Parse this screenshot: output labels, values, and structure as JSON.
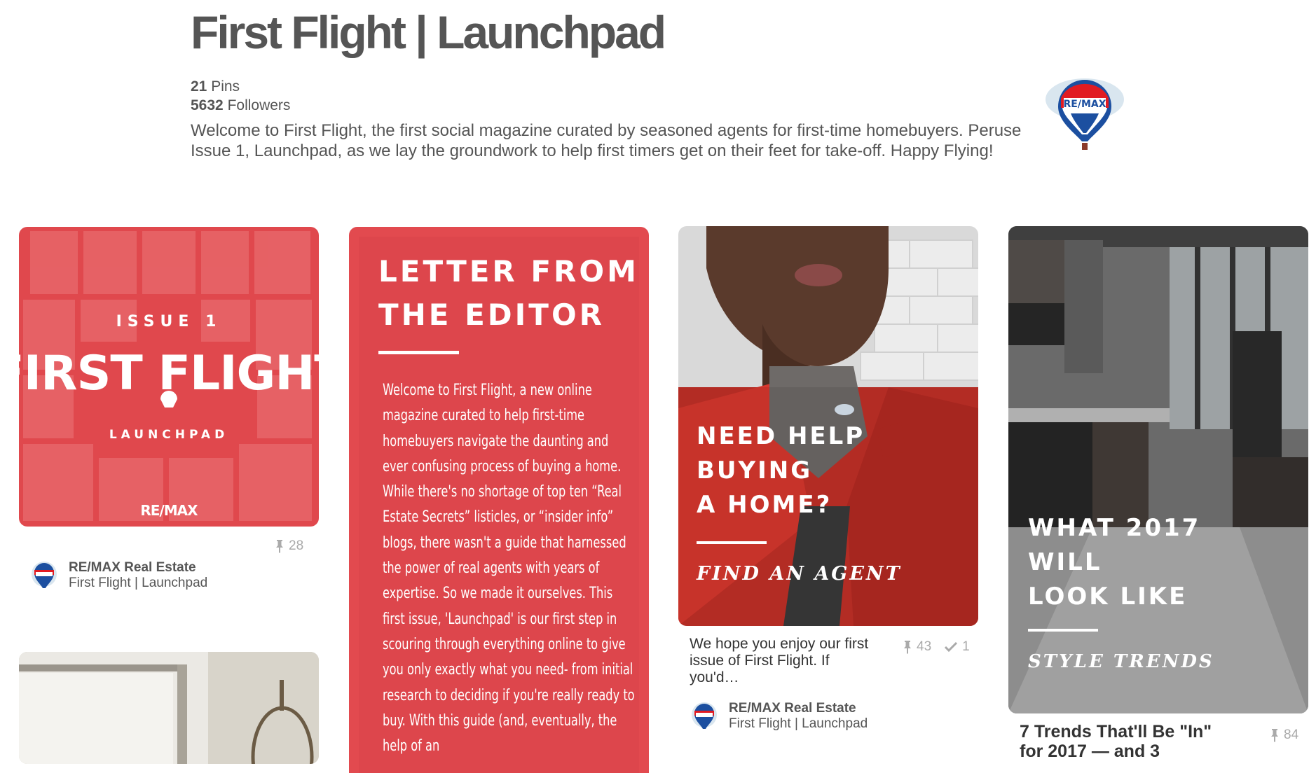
{
  "board": {
    "title": "First Flight | Launchpad",
    "pins_count": "21",
    "pins_label": "Pins",
    "followers_count": "5632",
    "followers_label": "Followers",
    "description": "Welcome to First Flight, the first social magazine curated by seasoned agents for first-time homebuyers. Peruse Issue 1, Launchpad, as we lay the groundwork to help first timers get on their feet for take-off. Happy Flying!",
    "owner_logo_text": "RE/MAX"
  },
  "pins": [
    {
      "cover_issue": "ISSUE 1",
      "cover_title": "FIRST FLIGHT",
      "cover_subtitle": "LAUNCHPAD",
      "cover_brand": "RE/MAX",
      "repins": "28",
      "author": "RE/MAX Real Estate",
      "board": "First Flight | Launchpad"
    },
    {
      "heading_line1": "LETTER FROM",
      "heading_line2": "THE EDITOR",
      "body": "Welcome to First Flight, a new online magazine curated to help first-time homebuyers navigate the daunting and ever confusing process of buying a home. While there's no shortage of top ten “Real Estate Secrets” listicles, or “insider info” blogs, there wasn't a guide that harnessed the power of real agents with years of expertise. So we made it ourselves. This first issue, 'Launchpad' is our first step in scouring through everything online to give you only exactly what you need- from initial research to deciding if you're really ready to buy. With this guide (and, eventually, the help of an"
    },
    {
      "overlay_line1": "NEED HELP",
      "overlay_line2": "BUYING",
      "overlay_line3": "A HOME?",
      "overlay_cta": "FIND AN AGENT",
      "description": "We hope you enjoy our first issue of First Flight. If you'd…",
      "repins": "43",
      "likes": "1",
      "author": "RE/MAX Real Estate",
      "board": "First Flight | Launchpad"
    },
    {
      "overlay_line1": "WHAT 2017",
      "overlay_line2": "WILL",
      "overlay_line3": "LOOK LIKE",
      "overlay_cta": "STYLE TRENDS",
      "description": "7 Trends That'll Be \"In\" for 2017 — and 3",
      "repins": "84"
    }
  ],
  "colors": {
    "cover_red": "#e0484d",
    "text_gray": "#555555",
    "meta_gray": "#aaaaaa"
  }
}
